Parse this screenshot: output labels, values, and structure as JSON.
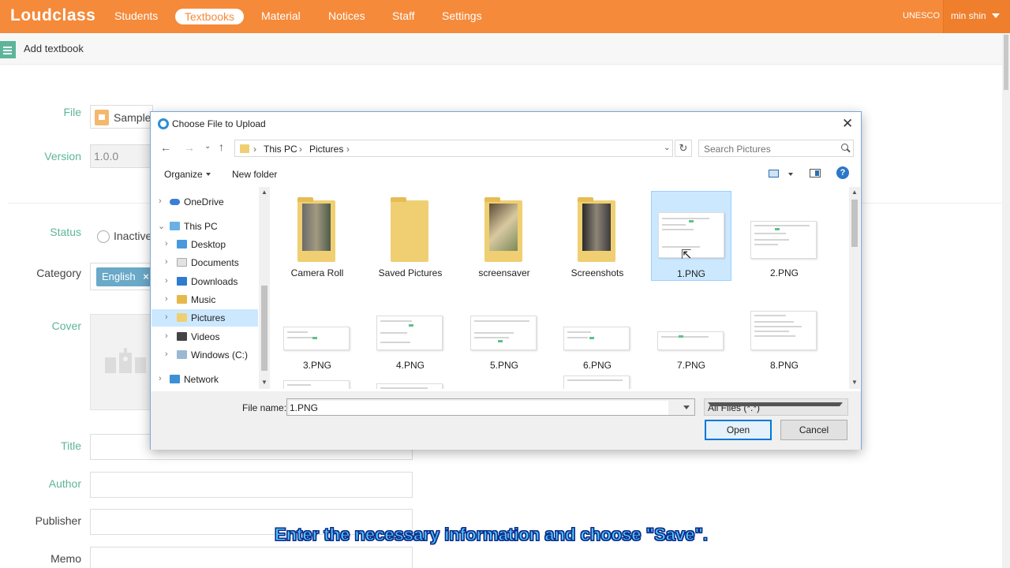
{
  "app": {
    "logo": "Loudclass",
    "nav": [
      "Students",
      "Textbooks",
      "Material",
      "Notices",
      "Staff",
      "Settings"
    ],
    "active_nav": "Textbooks",
    "org": "UNESCO",
    "user": "min shin"
  },
  "page": {
    "title": "Add textbook",
    "labels": {
      "file": "File",
      "version": "Version",
      "status": "Status",
      "category": "Category",
      "cover": "Cover",
      "title": "Title",
      "author": "Author",
      "publisher": "Publisher",
      "memo": "Memo"
    },
    "file_value": "Sample",
    "version_value": "1.0.0",
    "status_option": "Inactive",
    "category_tag": "English",
    "tag_remove": "×"
  },
  "dialog": {
    "title": "Choose File to Upload",
    "close": "✕",
    "path": [
      "This PC",
      "Pictures"
    ],
    "search_placeholder": "Search Pictures",
    "organize": "Organize",
    "new_folder": "New folder",
    "help": "?",
    "nav_pane": [
      {
        "label": "OneDrive",
        "level": 0,
        "icon": "cloud-icon"
      },
      {
        "label": "This PC",
        "level": 0,
        "icon": "pc-icon",
        "expanded": true
      },
      {
        "label": "Desktop",
        "level": 1,
        "icon": "desktop-icon"
      },
      {
        "label": "Documents",
        "level": 1,
        "icon": "documents-icon"
      },
      {
        "label": "Downloads",
        "level": 1,
        "icon": "downloads-icon"
      },
      {
        "label": "Music",
        "level": 1,
        "icon": "music-icon"
      },
      {
        "label": "Pictures",
        "level": 1,
        "icon": "pictures-icon",
        "selected": true
      },
      {
        "label": "Videos",
        "level": 1,
        "icon": "videos-icon"
      },
      {
        "label": "Windows (C:)",
        "level": 1,
        "icon": "drive-icon"
      },
      {
        "label": "Network",
        "level": 0,
        "icon": "network-icon"
      }
    ],
    "items": [
      {
        "name": "Camera Roll",
        "kind": "folder"
      },
      {
        "name": "Saved Pictures",
        "kind": "folder"
      },
      {
        "name": "screensaver",
        "kind": "folder"
      },
      {
        "name": "Screenshots",
        "kind": "folder"
      },
      {
        "name": "1.PNG",
        "kind": "image",
        "selected": true
      },
      {
        "name": "2.PNG",
        "kind": "image"
      },
      {
        "name": "3.PNG",
        "kind": "image"
      },
      {
        "name": "4.PNG",
        "kind": "image"
      },
      {
        "name": "5.PNG",
        "kind": "image"
      },
      {
        "name": "6.PNG",
        "kind": "image"
      },
      {
        "name": "7.PNG",
        "kind": "image"
      },
      {
        "name": "8.PNG",
        "kind": "image"
      }
    ],
    "file_name_label": "File name:",
    "file_name_value": "1.PNG",
    "file_type": "All Files (*.*)",
    "open": "Open",
    "cancel": "Cancel"
  },
  "caption": "Enter the necessary information and choose \"Save\".",
  "colors": {
    "brand": "#f58a3a",
    "label_green": "#5cb59a",
    "selection": "#cce8ff",
    "accent_blue": "#0078d7"
  }
}
